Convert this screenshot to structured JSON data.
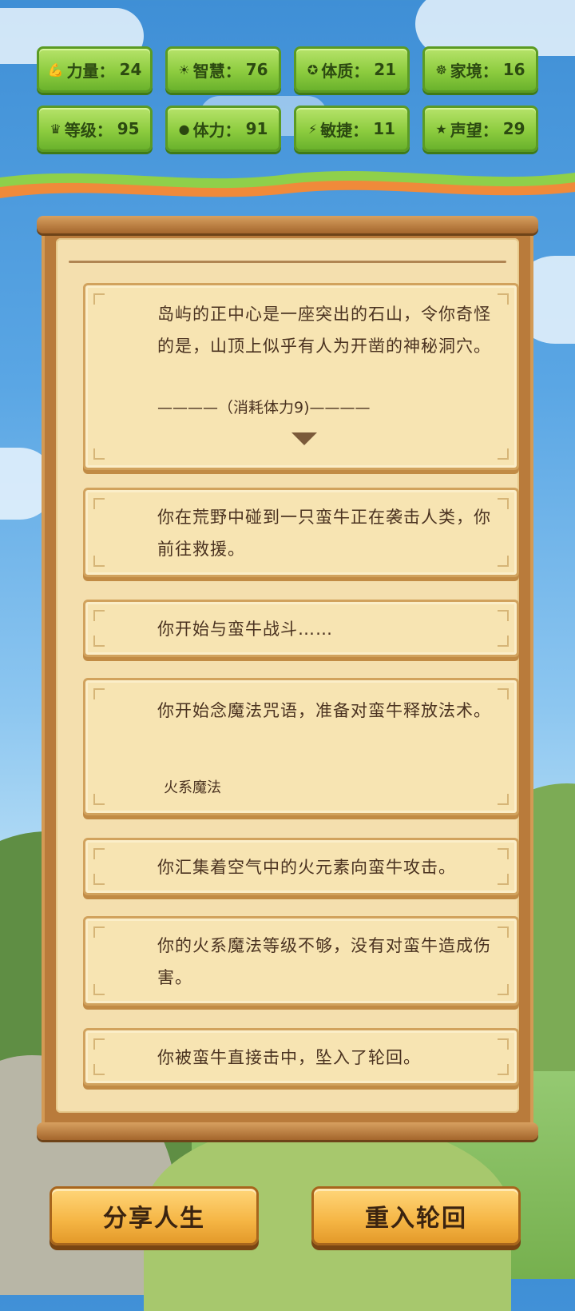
{
  "stats": [
    {
      "icon": "strength-icon",
      "glyph": "💪",
      "label": "力量：",
      "value": "24"
    },
    {
      "icon": "wisdom-icon",
      "glyph": "☀",
      "label": "智慧：",
      "value": "76"
    },
    {
      "icon": "constitution-icon",
      "glyph": "✪",
      "label": "体质：",
      "value": "21"
    },
    {
      "icon": "family-icon",
      "glyph": "☸",
      "label": "家境：",
      "value": "16"
    },
    {
      "icon": "level-icon",
      "glyph": "♛",
      "label": "等级：",
      "value": "95"
    },
    {
      "icon": "stamina-icon",
      "glyph": "●",
      "label": "体力：",
      "value": "91"
    },
    {
      "icon": "agility-icon",
      "glyph": "⚡",
      "label": "敏捷：",
      "value": "11"
    },
    {
      "icon": "reputation-icon",
      "glyph": "★",
      "label": "声望：",
      "value": "29"
    }
  ],
  "events": {
    "e1": {
      "text": "岛屿的正中心是一座突出的石山，令你奇怪的是，山顶上似乎有人为开凿的神秘洞穴。",
      "cost": "————（消耗体力9)————"
    },
    "e2": {
      "text": "你在荒野中碰到一只蛮牛正在袭击人类，你前往救援。"
    },
    "e3": {
      "text": "你开始与蛮牛战斗……"
    },
    "e4": {
      "text": "你开始念魔法咒语，准备对蛮牛释放法术。",
      "sub": "火系魔法"
    },
    "e5": {
      "text": "你汇集着空气中的火元素向蛮牛攻击。"
    },
    "e6": {
      "text": "你的火系魔法等级不够，没有对蛮牛造成伤害。"
    },
    "e7": {
      "text": "你被蛮牛直接击中，坠入了轮回。"
    }
  },
  "buttons": {
    "share": "分享人生",
    "reincarnate": "重入轮回"
  }
}
